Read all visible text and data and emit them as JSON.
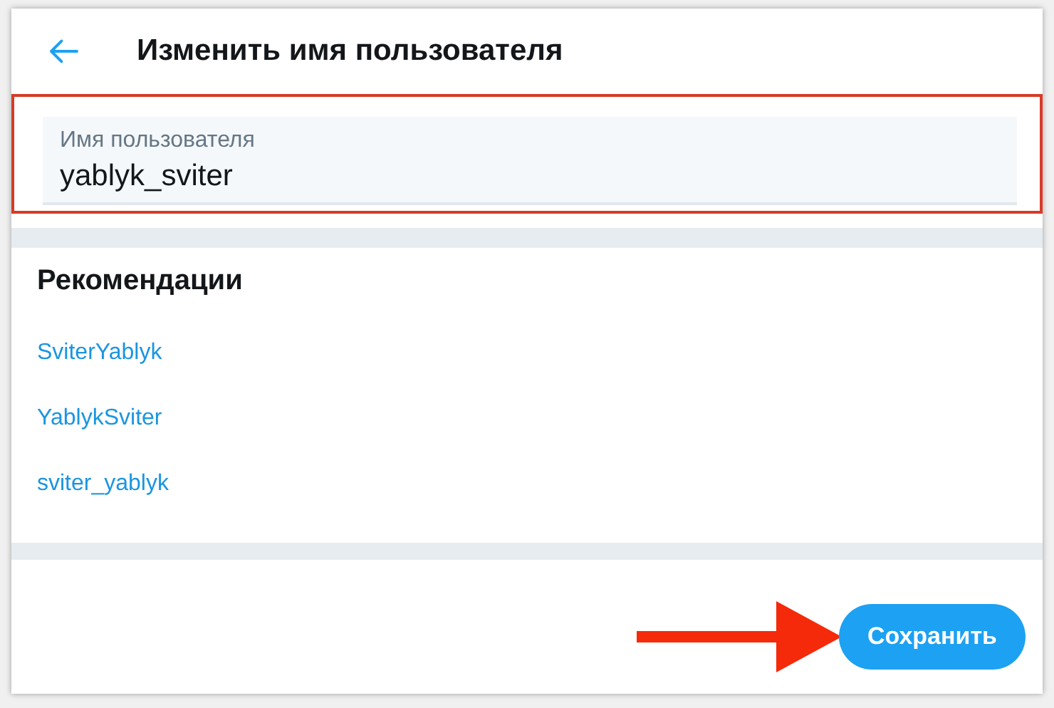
{
  "header": {
    "title": "Изменить имя пользователя"
  },
  "username_field": {
    "label": "Имя пользователя",
    "value": "yablyk_sviter",
    "highlighted": true
  },
  "recommendations": {
    "title": "Рекомендации",
    "items": [
      {
        "label": "SviterYablyk"
      },
      {
        "label": "YablykSviter"
      },
      {
        "label": "sviter_yablyk"
      }
    ]
  },
  "save_button": {
    "label": "Сохранить",
    "pointed_by_arrow": true
  }
}
